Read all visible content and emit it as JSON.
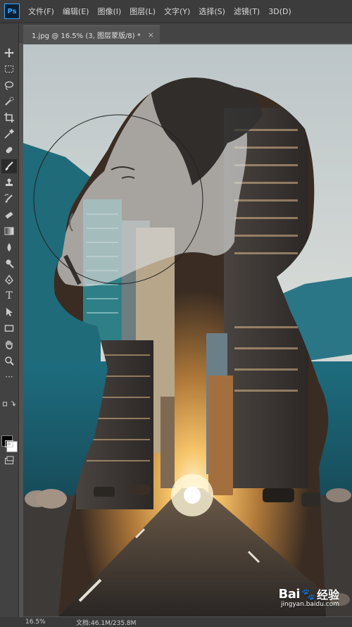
{
  "menubar": {
    "logo": "Ps",
    "items": [
      "文件(F)",
      "编辑(E)",
      "图像(I)",
      "图层(L)",
      "文字(Y)",
      "选择(S)",
      "滤镜(T)",
      "3D(D)"
    ]
  },
  "tab": {
    "title": "1.jpg @ 16.5% (3, 图层蒙版/8) *",
    "close": "×"
  },
  "toolbar": {
    "icons": [
      "move-tool",
      "marquee-tool",
      "lasso-tool",
      "quick-select-tool",
      "crop-tool",
      "eyedropper-tool",
      "healing-brush-tool",
      "brush-tool",
      "clone-stamp-tool",
      "history-brush-tool",
      "eraser-tool",
      "gradient-tool",
      "blur-tool",
      "dodge-tool",
      "pen-tool",
      "type-tool",
      "path-select-tool",
      "rectangle-tool",
      "hand-tool",
      "zoom-tool",
      "more-tools"
    ],
    "active": "brush-tool",
    "type_glyph": "T",
    "more_glyph": "···"
  },
  "colors": {
    "foreground": "#000000",
    "background": "#ffffff"
  },
  "status": {
    "zoom": "16.5%",
    "doc": "文档:46.1M/235.8M"
  },
  "watermark": {
    "brand": "Bai",
    "paw": "🐾",
    "cn": "经验",
    "url": "jingyan.baidu.com"
  }
}
